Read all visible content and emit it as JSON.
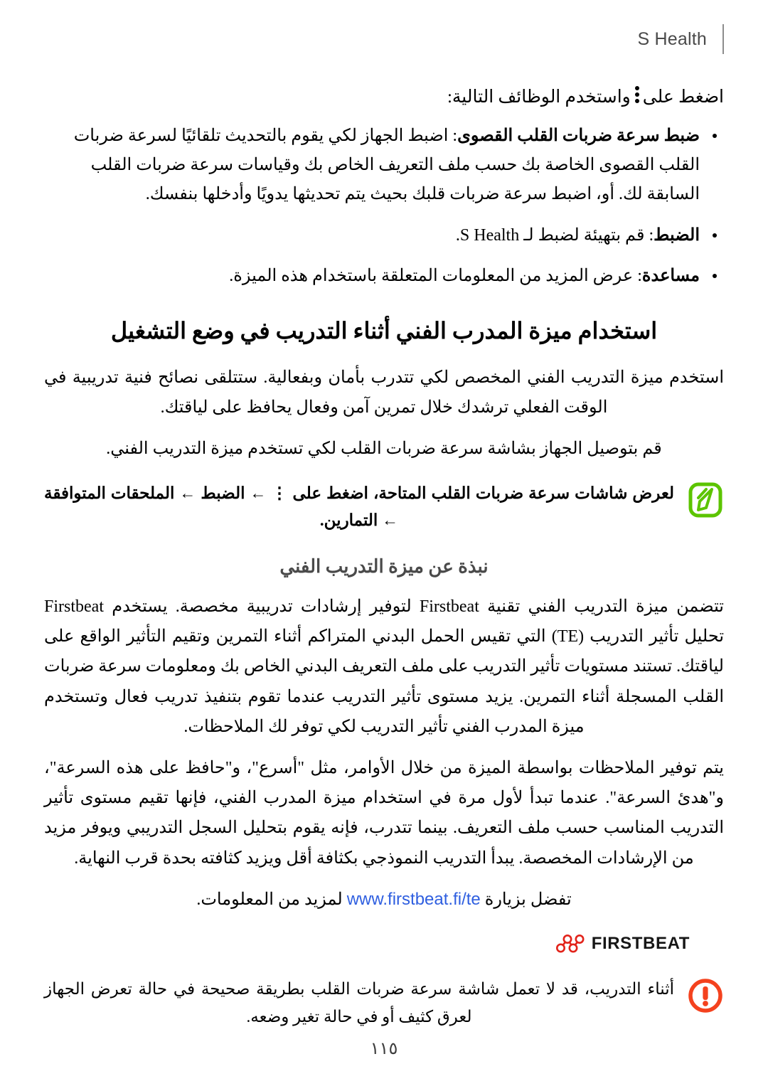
{
  "header": {
    "title": "S Health"
  },
  "intro": {
    "before_icon": "اضغط على",
    "icon": "more-options-icon",
    "after_icon": "واستخدم الوظائف التالية:"
  },
  "bullets": [
    {
      "label": "ضبط سرعة ضربات القلب القصوى",
      "text": ": اضبط الجهاز لكي يقوم بالتحديث تلقائيًا لسرعة ضربات القلب القصوى الخاصة بك حسب ملف التعريف الخاص بك وقياسات سرعة ضربات القلب السابقة لك. أو، اضبط سرعة ضربات قلبك بحيث يتم تحديثها يدويًا وأدخلها بنفسك."
    },
    {
      "label": "الضبط",
      "text": ": قم بتهيئة لضبط لـ S Health."
    },
    {
      "label": "مساعدة",
      "text": ": عرض المزيد من المعلومات المتعلقة باستخدام هذه الميزة."
    }
  ],
  "section": {
    "heading": "استخدام ميزة المدرب الفني أثناء التدريب في وضع التشغيل",
    "paragraph_1": "استخدم ميزة التدريب الفني المخصص لكي تتدرب بأمان وبفعالية. ستتلقى نصائح فنية تدريبية في الوقت الفعلي ترشدك خلال تمرين آمن وفعال يحافظ على لياقتك.",
    "paragraph_2": "قم بتوصيل الجهاز بشاشة سرعة ضربات القلب لكي تستخدم ميزة التدريب الفني."
  },
  "note_callout": {
    "icon": "note-pencil-icon",
    "icon_color": "#5cc400",
    "text": "لعرض شاشات سرعة ضربات القلب المتاحة، اضغط على ⋮ ← الضبط ← الملحقات المتوافقة ← التمارين."
  },
  "about": {
    "sub_heading": "نبذة عن ميزة التدريب الفني",
    "paragraph_1": "تتضمن ميزة التدريب الفني تقنية Firstbeat لتوفير إرشادات تدريبية مخصصة. يستخدم Firstbeat تحليل تأثير التدريب (TE) التي تقيس الحمل البدني المتراكم أثناء التمرين وتقيم التأثير الواقع على لياقتك. تستند مستويات تأثير التدريب على ملف التعريف البدني الخاص بك ومعلومات سرعة ضربات القلب المسجلة أثناء التمرين. يزيد مستوى تأثير التدريب عندما تقوم بتنفيذ تدريب فعال وتستخدم ميزة المدرب الفني تأثير التدريب لكي توفر لك الملاحظات.",
    "paragraph_2": "يتم توفير الملاحظات بواسطة الميزة من خلال الأوامر، مثل \"أسرع\"، و\"حافظ على هذه السرعة\"، و\"هدئ السرعة\". عندما تبدأ لأول مرة في استخدام ميزة المدرب الفني، فإنها تقيم مستوى تأثير التدريب المناسب حسب ملف التعريف. بينما تتدرب، فإنه يقوم بتحليل السجل التدريبي ويوفر مزيد من الإرشادات المخصصة. يبدأ التدريب النموذجي بكثافة أقل ويزيد كثافته بحدة قرب النهاية.",
    "link_line_prefix": "تفضل بزيارة",
    "link_text": "www.firstbeat.fi/te",
    "link_line_suffix": "لمزيد من المعلومات."
  },
  "logo": {
    "mark": "firstbeat-node-mark",
    "word": "FIRSTBEAT",
    "mark_color": "#e2231a"
  },
  "caution_callout": {
    "icon": "caution-exclamation-icon",
    "icon_color": "#f4421e",
    "text": "أثناء التدريب، قد لا تعمل شاشة سرعة ضربات القلب بطريقة صحيحة في حالة تعرض الجهاز لعرق كثيف أو في حالة تغير وضعه."
  },
  "footer": {
    "page_number": "١١٥"
  }
}
